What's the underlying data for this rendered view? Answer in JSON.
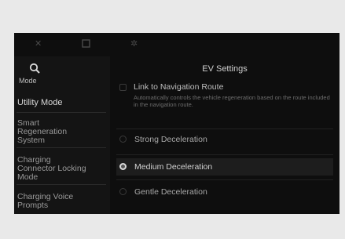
{
  "topbar": {
    "icons": [
      "close-icon",
      "home-icon",
      "settings-icon"
    ]
  },
  "sidebar": {
    "search_label": "Mode",
    "items": [
      {
        "label": "Utility Mode",
        "active": true
      },
      {
        "label": "Smart Regeneration System"
      },
      {
        "label": "Charging Connector Locking Mode"
      },
      {
        "label": "Charging Voice Prompts"
      }
    ]
  },
  "panel": {
    "title": "EV Settings",
    "link_option": {
      "label": "Link to Navigation Route",
      "description": "Automatically controls the vehicle regeneration based on the route included in the navigation route."
    },
    "options": [
      {
        "label": "Strong Deceleration",
        "selected": false
      },
      {
        "label": "Medium Deceleration",
        "selected": true
      },
      {
        "label": "Gentle Deceleration",
        "selected": false
      }
    ]
  }
}
